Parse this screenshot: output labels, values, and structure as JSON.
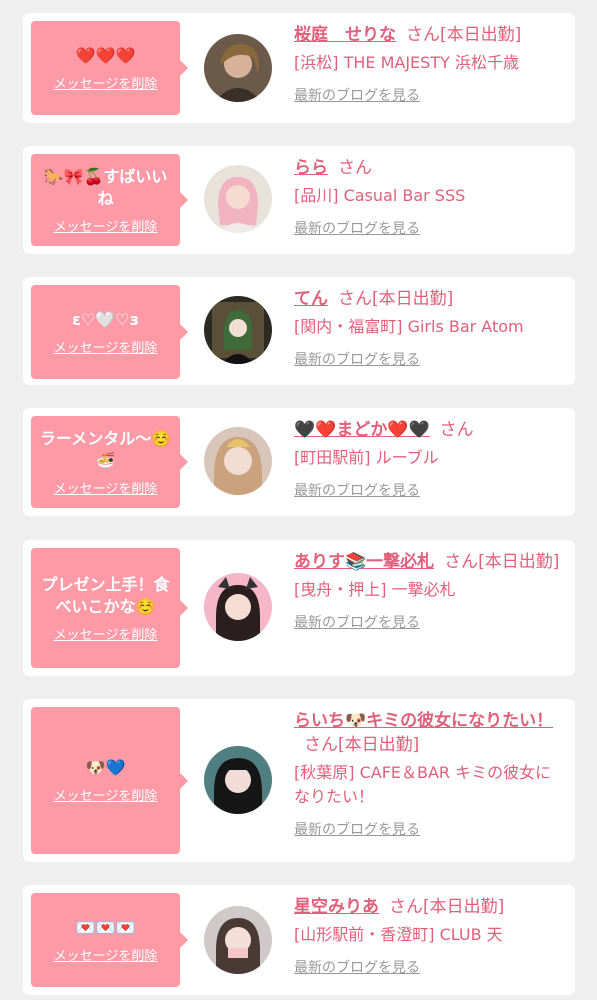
{
  "messages": [
    {
      "text": "❤️❤️❤️",
      "delete": "メッセージを削除",
      "name": "桜庭　せりな",
      "suffix": "さん[本日出勤]",
      "shop": "[浜松] THE MAJESTY 浜松千歳",
      "blog": "最新のブログを見る"
    },
    {
      "text": "🐎🎀🍒すばいいね",
      "delete": "メッセージを削除",
      "name": "らら",
      "suffix": "さん",
      "shop": "[品川] Casual Bar SSS",
      "blog": "最新のブログを見る"
    },
    {
      "text": "ε♡🤍♡з",
      "delete": "メッセージを削除",
      "name": "てん",
      "suffix": "さん[本日出勤]",
      "shop": "[関内・福富町] Girls Bar Atom",
      "blog": "最新のブログを見る"
    },
    {
      "text": "ラーメンタル〜☺️🍜",
      "delete": "メッセージを削除",
      "name": "🖤❤️まどか❤️🖤",
      "suffix": "さん",
      "shop": "[町田駅前] ルーブル",
      "blog": "最新のブログを見る"
    },
    {
      "text": "プレゼン上手！食べいこかな☺️",
      "delete": "メッセージを削除",
      "name": "ありす📚一撃必札",
      "suffix": "さん[本日出勤]",
      "shop": "[曳舟・押上] 一撃必札",
      "blog": "最新のブログを見る"
    },
    {
      "text": "🐶💙",
      "delete": "メッセージを削除",
      "name": "らいち🐶キミの彼女になりたい！",
      "suffix": "さん[本日出勤]",
      "shop": "[秋葉原] CAFE＆BAR キミの彼女になりたい！",
      "blog": "最新のブログを見る"
    },
    {
      "text": "💌💌💌",
      "delete": "メッセージを削除",
      "name": "星空みりあ",
      "suffix": "さん[本日出勤]",
      "shop": "[山形駅前・香澄町] CLUB 天",
      "blog": "最新のブログを見る"
    }
  ],
  "colors": {
    "accent": "#e0607c",
    "bubble": "#fe99a6",
    "background": "#efefef"
  }
}
